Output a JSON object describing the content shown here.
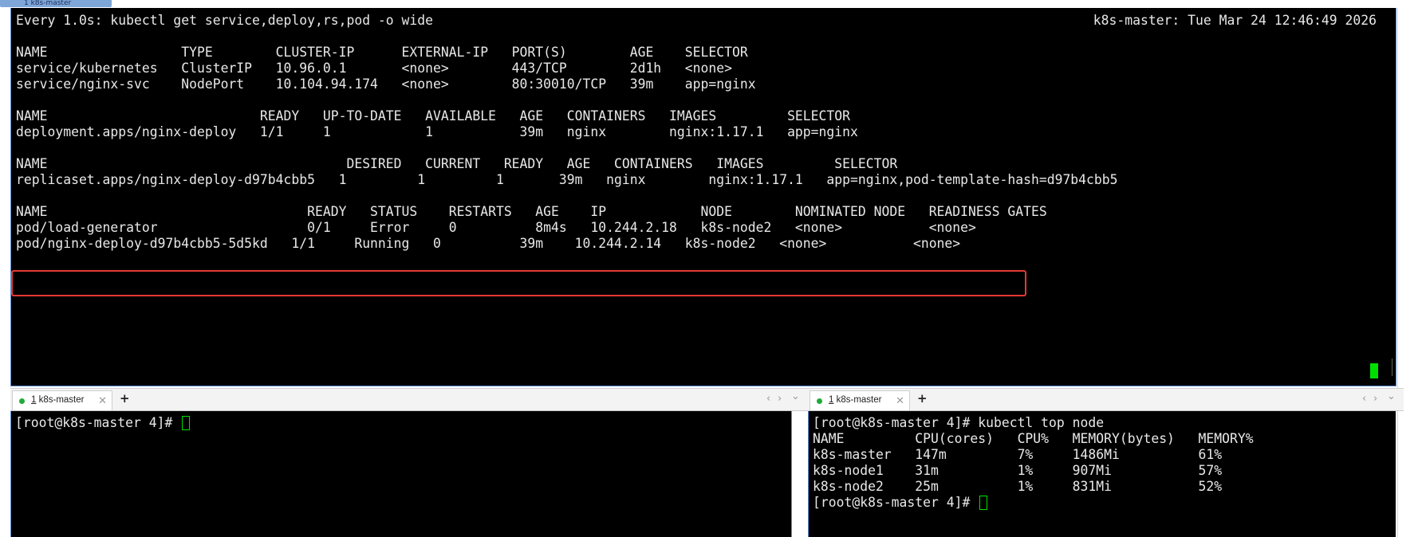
{
  "window": {
    "top_tab_label": "1 k8s-master"
  },
  "watch": {
    "header": "Every 1.0s: kubectl get service,deploy,rs,pod -o wide",
    "timestamp": "k8s-master: Tue Mar 24 12:46:49 2026",
    "services": {
      "header": "NAME                 TYPE        CLUSTER-IP      EXTERNAL-IP   PORT(S)        AGE    SELECTOR",
      "rows": [
        "service/kubernetes   ClusterIP   10.96.0.1       <none>        443/TCP        2d1h   <none>",
        "service/nginx-svc    NodePort    10.104.94.174   <none>        80:30010/TCP   39m    app=nginx"
      ]
    },
    "deployments": {
      "header": "NAME                           READY   UP-TO-DATE   AVAILABLE   AGE   CONTAINERS   IMAGES         SELECTOR",
      "rows": [
        "deployment.apps/nginx-deploy   1/1     1            1           39m   nginx        nginx:1.17.1   app=nginx"
      ]
    },
    "replicasets": {
      "header": "NAME                                      DESIRED   CURRENT   READY   AGE   CONTAINERS   IMAGES         SELECTOR",
      "rows": [
        "replicaset.apps/nginx-deploy-d97b4cbb5   1         1         1       39m   nginx        nginx:1.17.1   app=nginx,pod-template-hash=d97b4cbb5"
      ]
    },
    "pods": {
      "header": "NAME                                 READY   STATUS    RESTARTS   AGE    IP            NODE        NOMINATED NODE   READINESS GATES",
      "rows": [
        "pod/load-generator                   0/1     Error     0          8m4s   10.244.2.18   k8s-node2   <none>           <none>",
        "pod/nginx-deploy-d97b4cbb5-5d5kd   1/1     Running   0          39m    10.244.2.14   k8s-node2   <none>           <none>"
      ]
    }
  },
  "left_pane": {
    "tab_number": "1",
    "tab_name": "k8s-master",
    "prompt": "[root@k8s-master 4]# "
  },
  "right_pane": {
    "tab_number": "1",
    "tab_name": "k8s-master",
    "command": "[root@k8s-master 4]# kubectl top node",
    "table_header": "NAME         CPU(cores)   CPU%   MEMORY(bytes)   MEMORY%",
    "rows": [
      "k8s-master   147m         7%     1486Mi          61%",
      "k8s-node1    31m          1%     907Mi           57%",
      "k8s-node2    25m          1%     831Mi           52%"
    ],
    "prompt": "[root@k8s-master 4]# "
  },
  "controls": {
    "close_glyph": "✕",
    "add_glyph": "+",
    "prev_glyph": "‹",
    "next_glyph": "›",
    "menu_glyph": "⌄"
  },
  "colors": {
    "highlight": "#e53935",
    "cursor": "#00e000",
    "status_dot": "#1faa3a"
  }
}
